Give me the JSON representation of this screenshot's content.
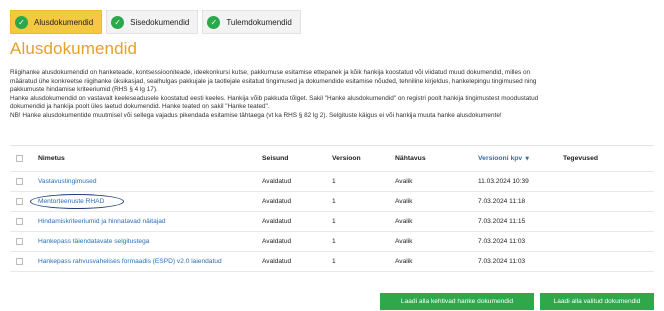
{
  "tabs": [
    {
      "label": "Alusdokumendid",
      "active": true
    },
    {
      "label": "Sisedokumendid",
      "active": false
    },
    {
      "label": "Tulemdokumendid",
      "active": false
    }
  ],
  "page_title": "Alusdokumendid",
  "description": [
    "Riigihanke alusdokumendid on hanketeade, kontsessiooniteade, ideekonkursi kutse, pakkumuse esitamise ettepanek ja kõik hankija koostatud või viidatud muud dokumendid, milles on",
    "määratud ühe konkreetse riigihanke üksikasjad, sealhulgas pakkujale ja taotlejale esitatud tingimused ja dokumendide esitamise nõuded, tehniline kirjeldus, hankelepingu tingimused ning",
    "pakkumuste hindamise kriteeriumid (RHS § 4 lg 17).",
    "Hanke alusdokumendid on vastavalt keeleseadusele koostatud eesti keeles. Hankija võib pakkuda tõlget. Sakil \"Hanke alusdokumendid\" on registri poolt hankija tingimustest moodustatud",
    "dokumendid ja hankija poolt üles laetud dokumendid. Hanke teated on sakil \"Hanke teated\".",
    "NB! Hanke alusdokumentide muutmisel või sellega vajadus pikendada esitamise tähtaega (vt ka RHS § 82 lg 2). Selgituste käigus ei või hankija muuta hanke alusdokumente!"
  ],
  "table": {
    "headers": {
      "name": "Nimetus",
      "status": "Seisund",
      "version": "Versioon",
      "visibility": "Nähtavus",
      "version_date": "Versiooni kpv",
      "actions": "Tegevused"
    },
    "rows": [
      {
        "name": "Vastavustingimused",
        "status": "Avaldatud",
        "version": "1",
        "visibility": "Avalik",
        "date": "11.03.2024 10:39"
      },
      {
        "name": "Mentorteenuste RHAD",
        "status": "Avaldatud",
        "version": "1",
        "visibility": "Avalik",
        "date": "7.03.2024 11:18"
      },
      {
        "name": "Hindamiskriteeriumid ja hinnatavad näitajad",
        "status": "Avaldatud",
        "version": "1",
        "visibility": "Avalik",
        "date": "7.03.2024 11:15"
      },
      {
        "name": "Hankepass täiendatavate selgitustega",
        "status": "Avaldatud",
        "version": "1",
        "visibility": "Avalik",
        "date": "7.03.2024 11:03"
      },
      {
        "name": "Hankepass rahvusvahelises formaadis (ESPD) v2.0 laiendatud",
        "status": "Avaldatud",
        "version": "1",
        "visibility": "Avalik",
        "date": "7.03.2024 11:03"
      }
    ]
  },
  "buttons": {
    "download_valid": "Laadi alla kehtivad hanke dokumendid",
    "download_selected": "Laadi alla valitud dokumendid"
  },
  "colors": {
    "accent_title": "#e7a12a",
    "active_tab": "#f5c842",
    "link": "#2a6fb8",
    "button": "#2fa84c"
  }
}
